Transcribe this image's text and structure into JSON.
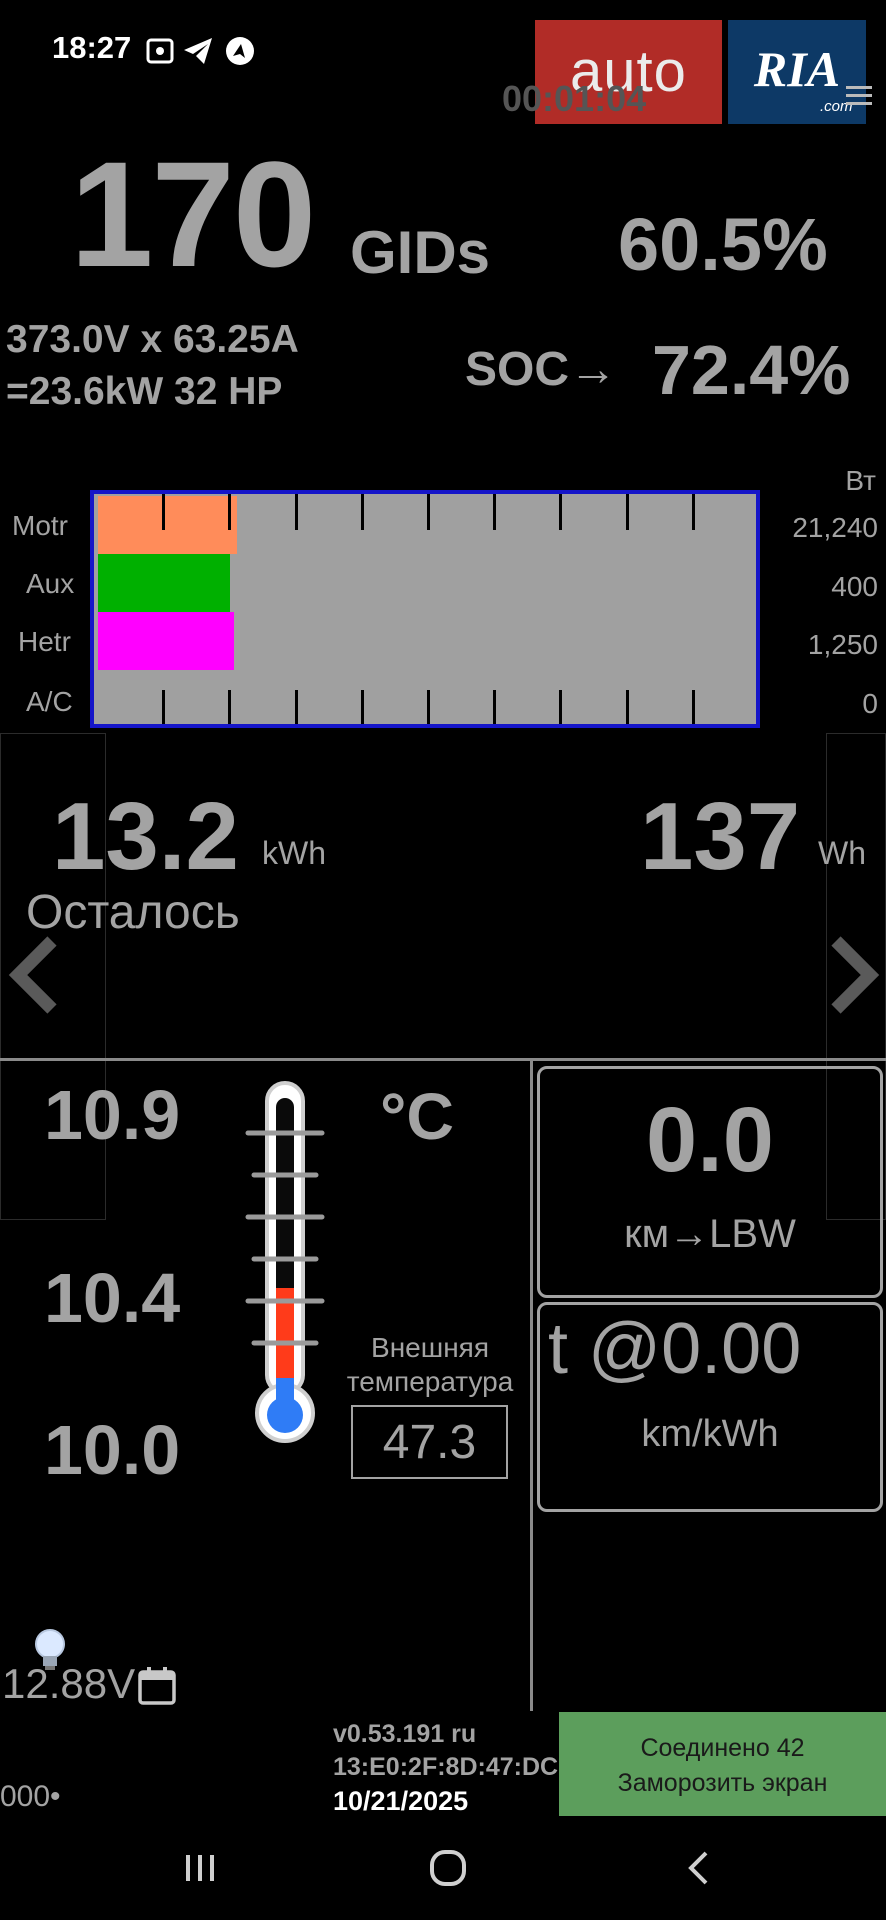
{
  "status_bar": {
    "time": "18:27",
    "icons": [
      "screenshot-icon",
      "telegram-icon",
      "navigation-icon"
    ]
  },
  "watermark": {
    "auto": "auto",
    "ria": "RIA",
    "com": ".com"
  },
  "timer": "00:01:04",
  "gids": {
    "value": "170",
    "label": "GIDs",
    "percent": "60.5%"
  },
  "power": {
    "line1": "373.0V x 63.25A",
    "line2": "=23.6kW  32 HP"
  },
  "soc": {
    "label": "SOC→",
    "value": "72.4%"
  },
  "consumption": {
    "unit": "Вт",
    "items": [
      {
        "label": "Motr",
        "value": "21,240",
        "color": "#ff8c5a",
        "fill": 0.21
      },
      {
        "label": "Aux",
        "value": "400",
        "color": "#00b000",
        "fill": 0.2
      },
      {
        "label": "Hetr",
        "value": "1,250",
        "color": "#ff00ff",
        "fill": 0.205
      },
      {
        "label": "A/C",
        "value": "0",
        "color": "#a0a0a0",
        "fill": 0
      }
    ]
  },
  "energy": {
    "remaining_value": "13.2",
    "remaining_unit": "kWh",
    "remaining_label": "Осталось",
    "wh_value": "137",
    "wh_unit": "Wh"
  },
  "temperatures": {
    "values": [
      "10.9",
      "10.4",
      "10.0"
    ],
    "unit": "°C",
    "outside_label_1": "Внешняя",
    "outside_label_2": "температура",
    "outside_value": "47.3"
  },
  "range": {
    "value": "0.0",
    "label": "км→LBW"
  },
  "efficiency": {
    "value": "t @0.00",
    "label": "km/kWh"
  },
  "footer": {
    "aux_voltage": "12.88V",
    "dots": "000•",
    "version": "v0.53.191 ru",
    "mac": "13:E0:2F:8D:47:DC",
    "date": "10/21/2025",
    "connect_line1": "Соединено 42",
    "connect_line2": "Заморозить экран"
  }
}
